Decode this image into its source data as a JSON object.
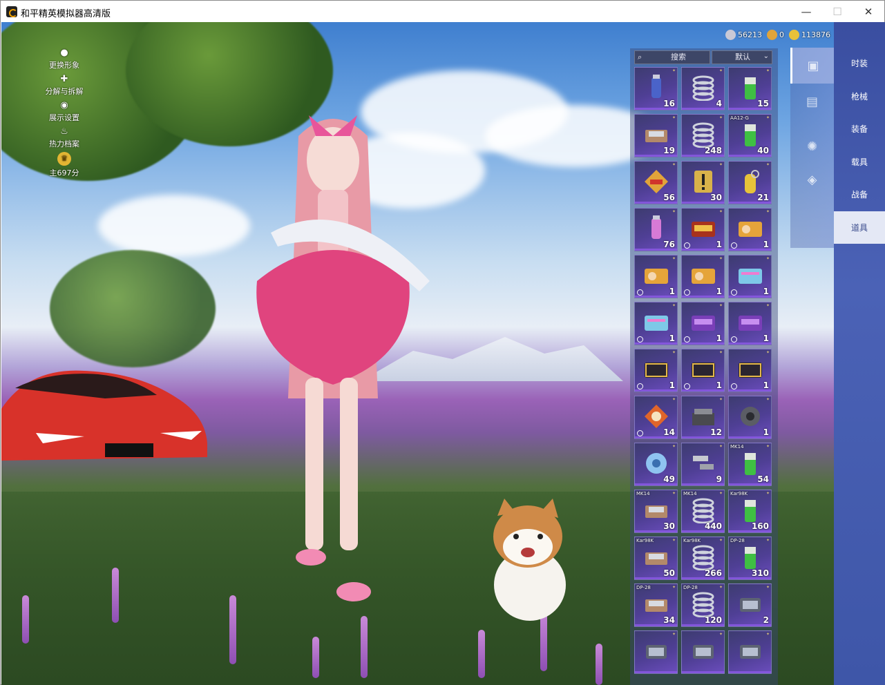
{
  "window": {
    "title": "和平精英模拟器高清版",
    "minimize": "—",
    "maximize": "☐",
    "close": "✕"
  },
  "left_menu": [
    {
      "label": "更换形象",
      "icon": "person-icon"
    },
    {
      "label": "分解与拆解",
      "icon": "puzzle-icon"
    },
    {
      "label": "展示设置",
      "icon": "eye-icon"
    },
    {
      "label": "热力档案",
      "icon": "flame-icon"
    },
    {
      "label": "主697分",
      "icon": "rank-badge-icon"
    }
  ],
  "currency": [
    {
      "value": "56213",
      "color": "#c9c9d6",
      "icon": "silver-coin-icon"
    },
    {
      "value": "0",
      "color": "#e1a43a",
      "icon": "gold-token-icon"
    },
    {
      "value": "113876",
      "color": "#e8c23a",
      "icon": "gold-coin-icon"
    }
  ],
  "inventory": {
    "search_label": "搜索",
    "sort_label": "默认",
    "items": [
      {
        "count": "16",
        "label": "",
        "art": "spray-can",
        "timer": false
      },
      {
        "count": "4",
        "label": "",
        "art": "spring",
        "timer": false
      },
      {
        "count": "15",
        "label": "",
        "art": "battery-green",
        "timer": false
      },
      {
        "count": "19",
        "label": "",
        "art": "mag-box",
        "timer": false
      },
      {
        "count": "248",
        "label": "",
        "art": "spring",
        "timer": false
      },
      {
        "count": "40",
        "label": "AA12-G",
        "art": "battery-green",
        "timer": false
      },
      {
        "count": "56",
        "label": "",
        "art": "card-gold",
        "timer": false
      },
      {
        "count": "30",
        "label": "",
        "art": "exclaim-card",
        "timer": false
      },
      {
        "count": "21",
        "label": "",
        "art": "grenade-yellow",
        "timer": false
      },
      {
        "count": "76",
        "label": "",
        "art": "spray-can-pink",
        "timer": false
      },
      {
        "count": "1",
        "label": "",
        "art": "ticket-red",
        "timer": true
      },
      {
        "count": "1",
        "label": "",
        "art": "ticket-gold",
        "timer": true
      },
      {
        "count": "1",
        "label": "",
        "art": "ticket-gold",
        "timer": true
      },
      {
        "count": "1",
        "label": "",
        "art": "ticket-gold",
        "timer": true
      },
      {
        "count": "1",
        "label": "",
        "art": "ticket-rainbow",
        "timer": true
      },
      {
        "count": "1",
        "label": "",
        "art": "ticket-rainbow",
        "timer": true
      },
      {
        "count": "1",
        "label": "",
        "art": "ticket-purple",
        "timer": true
      },
      {
        "count": "1",
        "label": "",
        "art": "ticket-purple",
        "timer": true
      },
      {
        "count": "1",
        "label": "",
        "art": "ticket-black",
        "timer": true
      },
      {
        "count": "1",
        "label": "",
        "art": "ticket-black",
        "timer": true
      },
      {
        "count": "1",
        "label": "",
        "art": "ticket-black",
        "timer": true
      },
      {
        "count": "14",
        "label": "",
        "art": "badge-orange",
        "timer": true
      },
      {
        "count": "12",
        "label": "",
        "art": "parts-box",
        "timer": false
      },
      {
        "count": "1",
        "label": "",
        "art": "gear-part",
        "timer": false
      },
      {
        "count": "49",
        "label": "",
        "art": "disc-blue",
        "timer": false
      },
      {
        "count": "9",
        "label": "",
        "art": "gun-parts",
        "timer": false
      },
      {
        "count": "54",
        "label": "MK14",
        "art": "battery-green",
        "timer": false
      },
      {
        "count": "30",
        "label": "MK14",
        "art": "mag-box",
        "timer": false
      },
      {
        "count": "440",
        "label": "MK14",
        "art": "spring",
        "timer": false
      },
      {
        "count": "160",
        "label": "Kar98K",
        "art": "battery-green",
        "timer": false
      },
      {
        "count": "50",
        "label": "Kar98K",
        "art": "mag-box",
        "timer": false
      },
      {
        "count": "266",
        "label": "Kar98K",
        "art": "spring",
        "timer": false
      },
      {
        "count": "310",
        "label": "DP-28",
        "art": "battery-green",
        "timer": false
      },
      {
        "count": "34",
        "label": "DP-28",
        "art": "mag-box",
        "timer": false
      },
      {
        "count": "120",
        "label": "DP-28",
        "art": "spring",
        "timer": false
      },
      {
        "count": "2",
        "label": "",
        "art": "ticket-silver",
        "timer": false
      },
      {
        "count": "",
        "label": "",
        "art": "ticket-silver",
        "timer": false
      },
      {
        "count": "",
        "label": "",
        "art": "ticket-silver",
        "timer": false
      },
      {
        "count": "",
        "label": "",
        "art": "ticket-silver",
        "timer": false
      }
    ]
  },
  "category_rail": [
    {
      "icon": "card-icon"
    },
    {
      "icon": "chest-icon"
    },
    {
      "icon": "burst-icon"
    },
    {
      "icon": "ticket-icon"
    }
  ],
  "right_nav": [
    {
      "label": "时装",
      "active": false
    },
    {
      "label": "枪械",
      "active": false
    },
    {
      "label": "装备",
      "active": false
    },
    {
      "label": "载具",
      "active": false
    },
    {
      "label": "战备",
      "active": false
    },
    {
      "label": "道具",
      "active": true
    }
  ]
}
